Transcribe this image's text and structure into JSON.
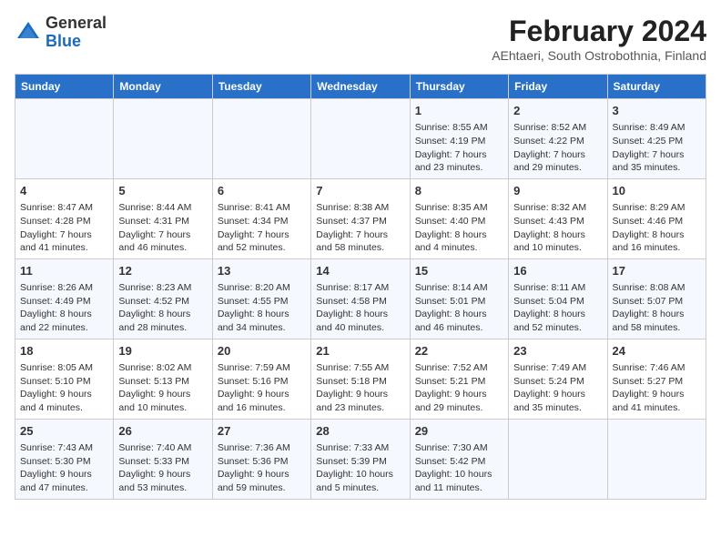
{
  "logo": {
    "general": "General",
    "blue": "Blue"
  },
  "header": {
    "month": "February 2024",
    "location": "AEhtaeri, South Ostrobothnia, Finland"
  },
  "weekdays": [
    "Sunday",
    "Monday",
    "Tuesday",
    "Wednesday",
    "Thursday",
    "Friday",
    "Saturday"
  ],
  "weeks": [
    [
      {
        "day": "",
        "info": ""
      },
      {
        "day": "",
        "info": ""
      },
      {
        "day": "",
        "info": ""
      },
      {
        "day": "",
        "info": ""
      },
      {
        "day": "1",
        "info": "Sunrise: 8:55 AM\nSunset: 4:19 PM\nDaylight: 7 hours\nand 23 minutes."
      },
      {
        "day": "2",
        "info": "Sunrise: 8:52 AM\nSunset: 4:22 PM\nDaylight: 7 hours\nand 29 minutes."
      },
      {
        "day": "3",
        "info": "Sunrise: 8:49 AM\nSunset: 4:25 PM\nDaylight: 7 hours\nand 35 minutes."
      }
    ],
    [
      {
        "day": "4",
        "info": "Sunrise: 8:47 AM\nSunset: 4:28 PM\nDaylight: 7 hours\nand 41 minutes."
      },
      {
        "day": "5",
        "info": "Sunrise: 8:44 AM\nSunset: 4:31 PM\nDaylight: 7 hours\nand 46 minutes."
      },
      {
        "day": "6",
        "info": "Sunrise: 8:41 AM\nSunset: 4:34 PM\nDaylight: 7 hours\nand 52 minutes."
      },
      {
        "day": "7",
        "info": "Sunrise: 8:38 AM\nSunset: 4:37 PM\nDaylight: 7 hours\nand 58 minutes."
      },
      {
        "day": "8",
        "info": "Sunrise: 8:35 AM\nSunset: 4:40 PM\nDaylight: 8 hours\nand 4 minutes."
      },
      {
        "day": "9",
        "info": "Sunrise: 8:32 AM\nSunset: 4:43 PM\nDaylight: 8 hours\nand 10 minutes."
      },
      {
        "day": "10",
        "info": "Sunrise: 8:29 AM\nSunset: 4:46 PM\nDaylight: 8 hours\nand 16 minutes."
      }
    ],
    [
      {
        "day": "11",
        "info": "Sunrise: 8:26 AM\nSunset: 4:49 PM\nDaylight: 8 hours\nand 22 minutes."
      },
      {
        "day": "12",
        "info": "Sunrise: 8:23 AM\nSunset: 4:52 PM\nDaylight: 8 hours\nand 28 minutes."
      },
      {
        "day": "13",
        "info": "Sunrise: 8:20 AM\nSunset: 4:55 PM\nDaylight: 8 hours\nand 34 minutes."
      },
      {
        "day": "14",
        "info": "Sunrise: 8:17 AM\nSunset: 4:58 PM\nDaylight: 8 hours\nand 40 minutes."
      },
      {
        "day": "15",
        "info": "Sunrise: 8:14 AM\nSunset: 5:01 PM\nDaylight: 8 hours\nand 46 minutes."
      },
      {
        "day": "16",
        "info": "Sunrise: 8:11 AM\nSunset: 5:04 PM\nDaylight: 8 hours\nand 52 minutes."
      },
      {
        "day": "17",
        "info": "Sunrise: 8:08 AM\nSunset: 5:07 PM\nDaylight: 8 hours\nand 58 minutes."
      }
    ],
    [
      {
        "day": "18",
        "info": "Sunrise: 8:05 AM\nSunset: 5:10 PM\nDaylight: 9 hours\nand 4 minutes."
      },
      {
        "day": "19",
        "info": "Sunrise: 8:02 AM\nSunset: 5:13 PM\nDaylight: 9 hours\nand 10 minutes."
      },
      {
        "day": "20",
        "info": "Sunrise: 7:59 AM\nSunset: 5:16 PM\nDaylight: 9 hours\nand 16 minutes."
      },
      {
        "day": "21",
        "info": "Sunrise: 7:55 AM\nSunset: 5:18 PM\nDaylight: 9 hours\nand 23 minutes."
      },
      {
        "day": "22",
        "info": "Sunrise: 7:52 AM\nSunset: 5:21 PM\nDaylight: 9 hours\nand 29 minutes."
      },
      {
        "day": "23",
        "info": "Sunrise: 7:49 AM\nSunset: 5:24 PM\nDaylight: 9 hours\nand 35 minutes."
      },
      {
        "day": "24",
        "info": "Sunrise: 7:46 AM\nSunset: 5:27 PM\nDaylight: 9 hours\nand 41 minutes."
      }
    ],
    [
      {
        "day": "25",
        "info": "Sunrise: 7:43 AM\nSunset: 5:30 PM\nDaylight: 9 hours\nand 47 minutes."
      },
      {
        "day": "26",
        "info": "Sunrise: 7:40 AM\nSunset: 5:33 PM\nDaylight: 9 hours\nand 53 minutes."
      },
      {
        "day": "27",
        "info": "Sunrise: 7:36 AM\nSunset: 5:36 PM\nDaylight: 9 hours\nand 59 minutes."
      },
      {
        "day": "28",
        "info": "Sunrise: 7:33 AM\nSunset: 5:39 PM\nDaylight: 10 hours\nand 5 minutes."
      },
      {
        "day": "29",
        "info": "Sunrise: 7:30 AM\nSunset: 5:42 PM\nDaylight: 10 hours\nand 11 minutes."
      },
      {
        "day": "",
        "info": ""
      },
      {
        "day": "",
        "info": ""
      }
    ]
  ]
}
